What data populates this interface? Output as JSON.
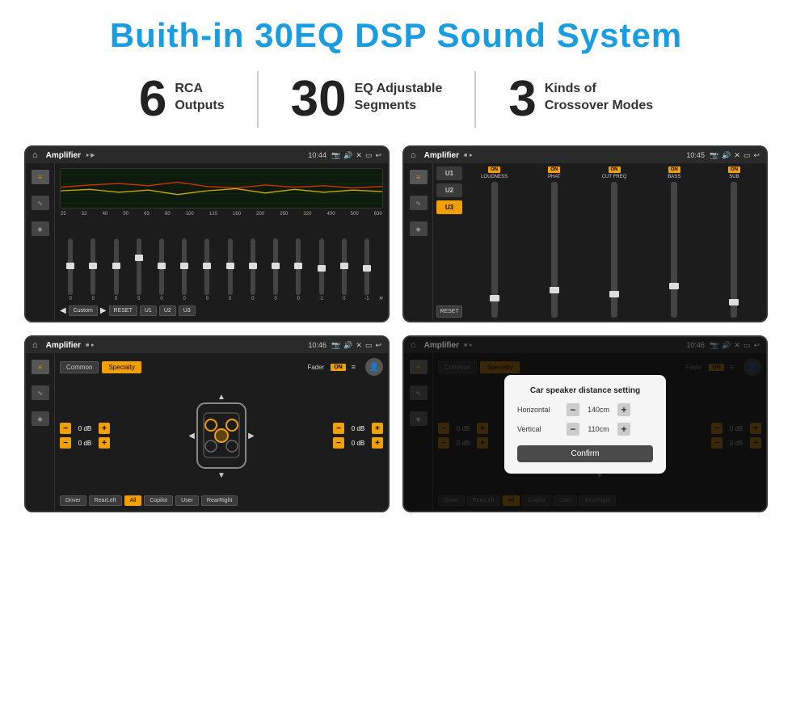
{
  "header": {
    "title": "Buith-in 30EQ DSP Sound System"
  },
  "stats": [
    {
      "number": "6",
      "label1": "RCA",
      "label2": "Outputs"
    },
    {
      "number": "30",
      "label1": "EQ Adjustable",
      "label2": "Segments"
    },
    {
      "number": "3",
      "label1": "Kinds of",
      "label2": "Crossover Modes"
    }
  ],
  "screens": [
    {
      "id": "screen1",
      "topbar_title": "Amplifier",
      "time": "10:44",
      "type": "eq",
      "freq_labels": [
        "25",
        "32",
        "40",
        "50",
        "63",
        "80",
        "100",
        "125",
        "160",
        "200",
        "250",
        "320",
        "400",
        "500",
        "630"
      ],
      "slider_values": [
        "0",
        "0",
        "0",
        "5",
        "0",
        "0",
        "0",
        "0",
        "0",
        "0",
        "0",
        "-1",
        "0",
        "-1"
      ],
      "buttons": [
        "Custom",
        "RESET",
        "U1",
        "U2",
        "U3"
      ]
    },
    {
      "id": "screen2",
      "topbar_title": "Amplifier",
      "time": "10:45",
      "type": "amp2",
      "channels": [
        "U1",
        "U2",
        "U3"
      ],
      "controls": [
        {
          "label": "LOUDNESS",
          "on": true
        },
        {
          "label": "PHAT",
          "on": true
        },
        {
          "label": "CUT FREQ",
          "on": true
        },
        {
          "label": "BASS",
          "on": true
        },
        {
          "label": "SUB",
          "on": true
        }
      ],
      "reset_label": "RESET"
    },
    {
      "id": "screen3",
      "topbar_title": "Amplifier",
      "time": "10:46",
      "type": "fader",
      "tabs": [
        "Common",
        "Specialty"
      ],
      "fader_label": "Fader",
      "on_label": "ON",
      "db_values": [
        "0 dB",
        "0 dB",
        "0 dB",
        "0 dB"
      ],
      "zone_buttons": [
        "Driver",
        "RearLeft",
        "All",
        "Copilot",
        "User",
        "RearRight"
      ]
    },
    {
      "id": "screen4",
      "topbar_title": "Amplifier",
      "time": "10:46",
      "type": "fader_dialog",
      "tabs": [
        "Common",
        "Specialty"
      ],
      "dialog": {
        "title": "Car speaker distance setting",
        "rows": [
          {
            "label": "Horizontal",
            "value": "140cm"
          },
          {
            "label": "Vertical",
            "value": "110cm"
          }
        ],
        "confirm_label": "Confirm"
      },
      "db_values": [
        "0 dB",
        "0 dB"
      ],
      "zone_buttons": [
        "Driver",
        "RearLeft",
        "All",
        "Copilot",
        "User",
        "RearRight"
      ]
    }
  ]
}
